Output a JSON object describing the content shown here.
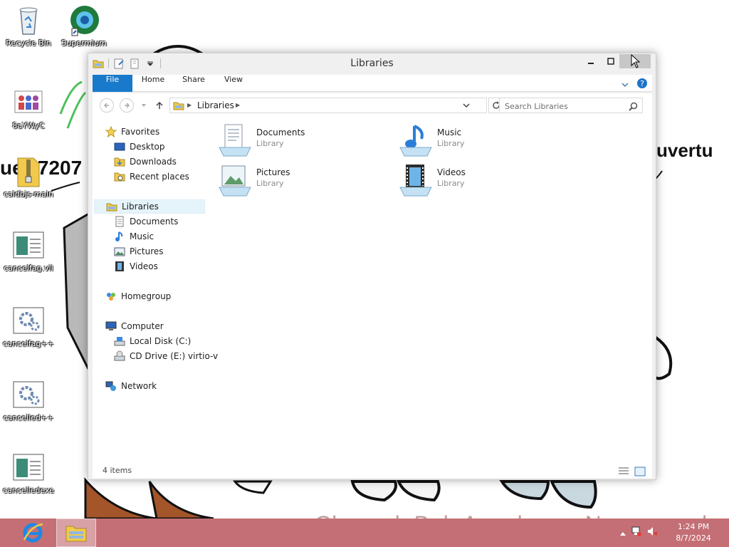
{
  "desktop": {
    "icons": [
      {
        "label": "Recycle Bin",
        "icon": "recycle-bin-icon"
      },
      {
        "label": "Supermium",
        "icon": "browser-icon"
      },
      {
        "label": "8aYWyC",
        "icon": "image-file-icon"
      },
      {
        "label": "caldbjs-main",
        "icon": "zip-folder-icon"
      },
      {
        "label": "cancelfag.vil",
        "icon": "generic-file-icon"
      },
      {
        "label": "cancelfag++",
        "icon": "gear-file-icon"
      },
      {
        "label": "cancelled++",
        "icon": "gear-file-icon"
      },
      {
        "label": "cancelledexe",
        "icon": "generic-file-icon"
      }
    ],
    "wallpaper_text_left": "uer:7207",
    "wallpaper_text_right": "uvertu",
    "watermark": "CherrydoBoloAconha on Newgrounds."
  },
  "window": {
    "title": "Libraries",
    "ribbon_tabs": {
      "file": "File",
      "home": "Home",
      "share": "Share",
      "view": "View"
    },
    "address": {
      "root": "Libraries"
    },
    "search_placeholder": "Search Libraries",
    "nav": {
      "favorites": "Favorites",
      "desktop": "Desktop",
      "downloads": "Downloads",
      "recent": "Recent places",
      "libraries": "Libraries",
      "documents": "Documents",
      "music": "Music",
      "pictures": "Pictures",
      "videos": "Videos",
      "homegroup": "Homegroup",
      "computer": "Computer",
      "local_disk": "Local Disk (C:)",
      "cd_drive": "CD Drive (E:) virtio-v",
      "network": "Network"
    },
    "items": [
      {
        "name": "Documents",
        "type": "Library"
      },
      {
        "name": "Music",
        "type": "Library"
      },
      {
        "name": "Pictures",
        "type": "Library"
      },
      {
        "name": "Videos",
        "type": "Library"
      }
    ],
    "status": "4 items"
  },
  "taskbar": {
    "time": "1:24 PM",
    "date": "8/7/2024"
  },
  "colors": {
    "accent": "#1979ca",
    "taskbar": "#c46f75",
    "nav_selected": "#e5f3fb"
  }
}
